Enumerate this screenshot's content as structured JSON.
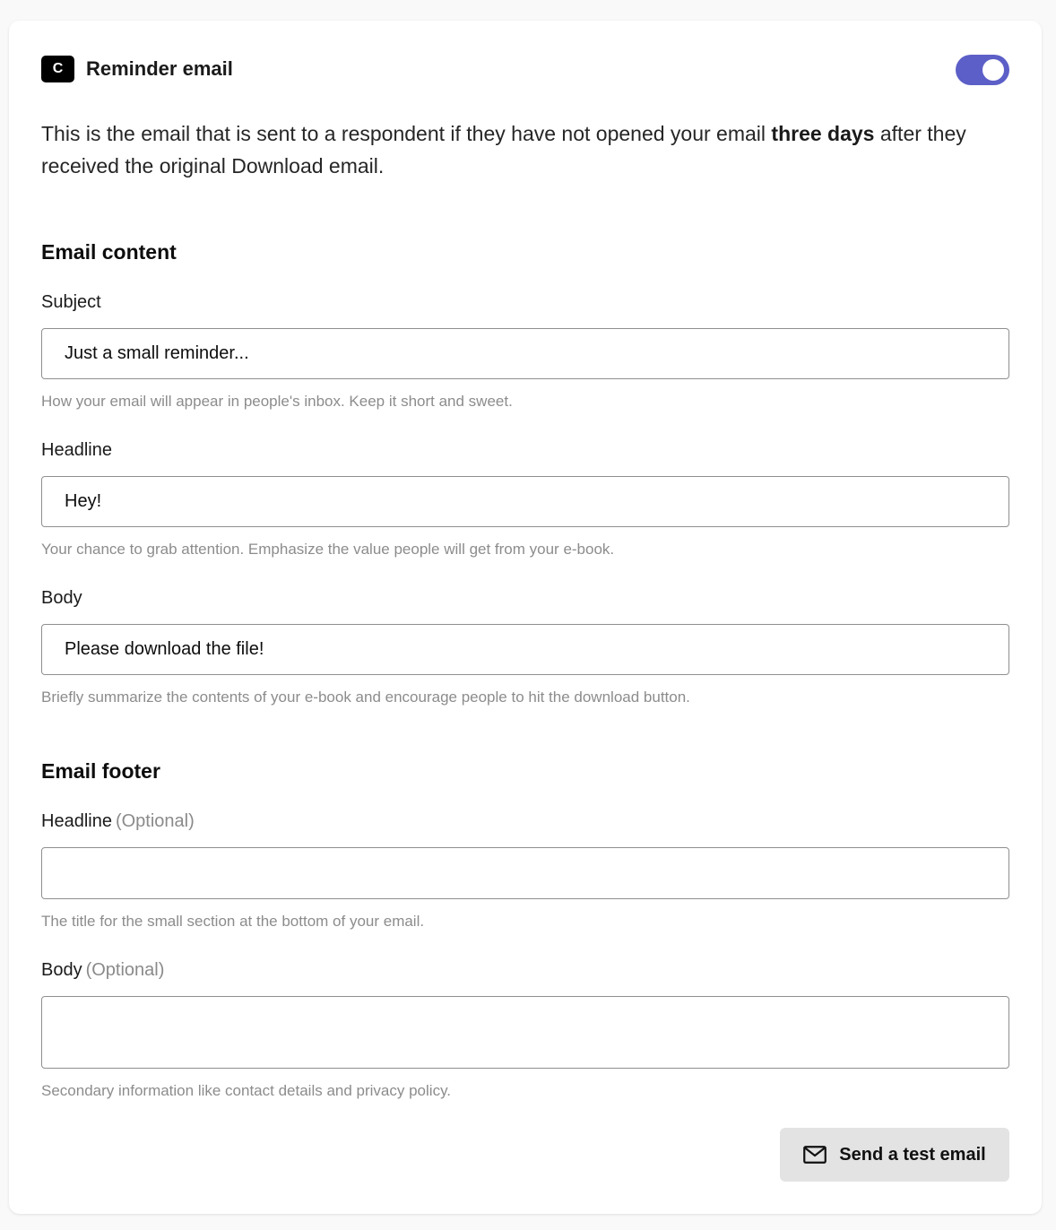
{
  "header": {
    "badge_letter": "C",
    "title": "Reminder email",
    "toggle_on": true
  },
  "description": {
    "before": "This is the email that is sent to a respondent if they have not opened your email ",
    "emphasis": "three days",
    "after": " after they received the original Download email."
  },
  "email_content": {
    "section_title": "Email content",
    "subject": {
      "label": "Subject",
      "value": "Just a small reminder...",
      "hint": "How your email will appear in people's inbox. Keep it short and sweet."
    },
    "headline": {
      "label": "Headline",
      "value": "Hey!",
      "hint": "Your chance to grab attention. Emphasize the value people will get from your e-book."
    },
    "body": {
      "label": "Body",
      "value": "Please download the file!",
      "hint": "Briefly summarize the contents of your e-book and encourage people to hit the download button."
    }
  },
  "email_footer": {
    "section_title": "Email footer",
    "headline": {
      "label": "Headline",
      "optional": "(Optional)",
      "value": "",
      "hint": "The title for the small section at the bottom of your email."
    },
    "body": {
      "label": "Body",
      "optional": "(Optional)",
      "value": "",
      "hint": "Secondary information like contact details and privacy policy."
    }
  },
  "actions": {
    "send_test_label": "Send a test email"
  },
  "colors": {
    "toggle_accent": "#5c5fc7",
    "badge_bg": "#000000",
    "hint_text": "#8c8c8c"
  }
}
